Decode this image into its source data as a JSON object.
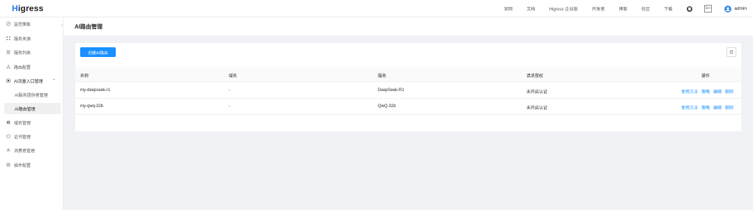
{
  "brand": {
    "logo_h": "H",
    "logo_rest": "igress"
  },
  "topnav": {
    "links": [
      "官网",
      "文档",
      "Higress 企业版",
      "开发者",
      "博客",
      "社区",
      "下载"
    ],
    "lang": "En",
    "username": "admin"
  },
  "sidebar": {
    "items": [
      {
        "label": "监控面板",
        "icon": "dashboard-icon"
      },
      {
        "label": "服务来源",
        "icon": "grid-icon"
      },
      {
        "label": "服务列表",
        "icon": "list-icon"
      },
      {
        "label": "路由配置",
        "icon": "route-icon"
      },
      {
        "label": "AI流量入口管理",
        "icon": "ai-icon"
      },
      {
        "label": "AI服务提供者管理"
      },
      {
        "label": "AI路由管理"
      },
      {
        "label": "域名管理",
        "icon": "globe-icon"
      },
      {
        "label": "证书管理",
        "icon": "certificate-icon"
      },
      {
        "label": "消费者管理",
        "icon": "user-icon"
      },
      {
        "label": "插件配置",
        "icon": "plugin-icon"
      }
    ]
  },
  "page": {
    "title": "AI路由管理"
  },
  "toolbar": {
    "create_label": "创建AI路由"
  },
  "table": {
    "headers": [
      "名称",
      "域名",
      "服务",
      "请求授权",
      "操作"
    ],
    "rows": [
      {
        "name": "my-deepseek-r1",
        "domain": "-",
        "service": "DeepSeek-R1",
        "auth": "未开启认证"
      },
      {
        "name": "my-qwq-32b",
        "domain": "-",
        "service": "QwQ-32b",
        "auth": "未开启认证"
      }
    ],
    "actions": [
      "使用方法",
      "策略",
      "编辑",
      "删除"
    ]
  },
  "colors": {
    "accent": "#1890ff",
    "background": "#f0f2f5"
  }
}
